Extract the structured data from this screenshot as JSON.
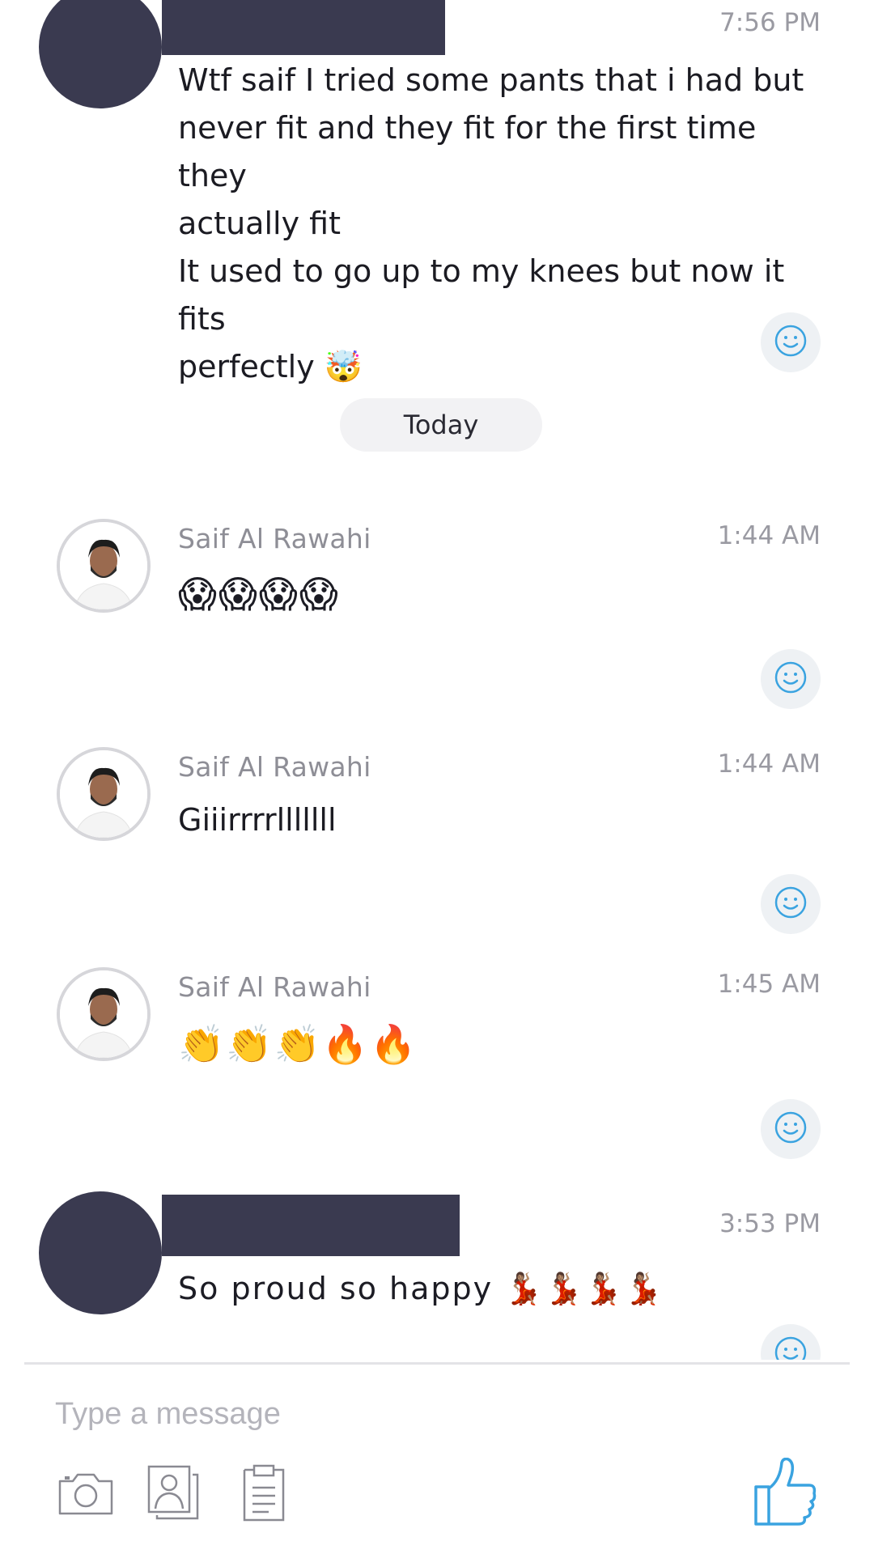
{
  "messages": [
    {
      "time": "7:56 PM",
      "lines": [
        "Wtf saif I tried some pants that i had but",
        "never fit and they fit for the first time they",
        "actually fit",
        "It used to go up to my knees but now it fits",
        "perfectly 🤯"
      ]
    },
    {
      "sender": "Saif Al Rawahi",
      "time": "1:44 AM",
      "text": "😱😱😱😱"
    },
    {
      "sender": "Saif Al Rawahi",
      "time": "1:44 AM",
      "text": "Giiirrrrlllllll"
    },
    {
      "sender": "Saif Al Rawahi",
      "time": "1:45 AM",
      "text": "👏👏👏🔥🔥"
    },
    {
      "time": "3:53 PM",
      "text": "So proud so happy 💃🏽💃🏽💃🏽💃🏽"
    }
  ],
  "divider": {
    "label": "Today"
  },
  "composer": {
    "placeholder": "Type a message"
  },
  "icons": {
    "reaction": "smiley-icon",
    "camera": "camera-icon",
    "gallery": "photo-gallery-icon",
    "document": "document-icon",
    "send": "thumbs-up-icon"
  },
  "colors": {
    "redaction": "#3a3a50",
    "accent": "#3aa3e0",
    "reaction_bg": "#eef1f4"
  }
}
